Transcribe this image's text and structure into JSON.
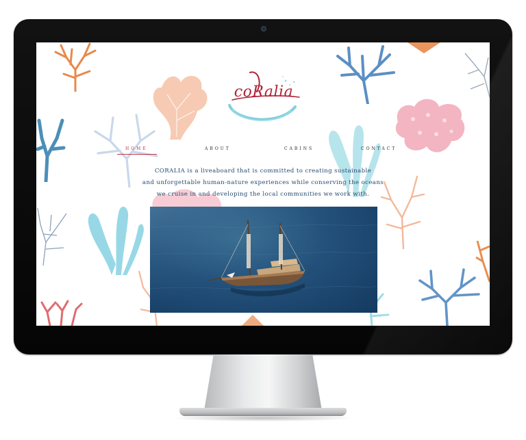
{
  "site": {
    "logo_text": "coRalia"
  },
  "nav": {
    "items": [
      {
        "label": "HOME",
        "active": true
      },
      {
        "label": "ABOUT",
        "active": false
      },
      {
        "label": "CABINS",
        "active": false
      },
      {
        "label": "CONTACT",
        "active": false
      }
    ]
  },
  "intro": {
    "line1": "CORALIA is a liveaboard that is committed to creating sustainable",
    "line2": "and unforgettable human-nature experiences while conserving the oceans",
    "line3": "we cruise in and developing the local communities we work with."
  },
  "colors": {
    "accent": "#c2364a",
    "text_blue": "#264a6e",
    "coral_orange": "#e8894a",
    "coral_blue": "#5b8fc4",
    "coral_pink": "#f0a3b3",
    "coral_teal": "#72c7d6",
    "coral_peach": "#f4b89a"
  },
  "hero_image": {
    "subject": "boat-on-ocean"
  }
}
